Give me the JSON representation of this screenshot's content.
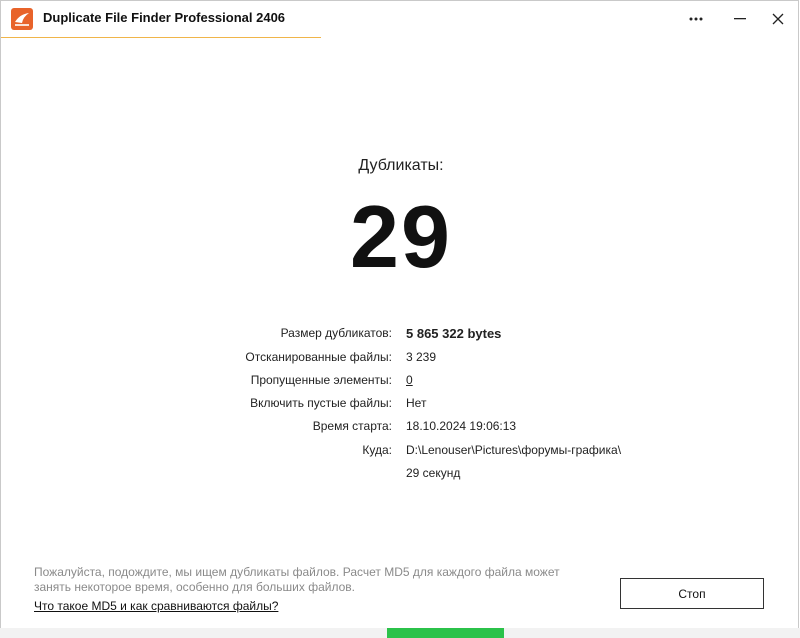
{
  "window": {
    "title": "Duplicate File Finder Professional 2406"
  },
  "duplicates": {
    "label": "Дубликаты:",
    "count": "29"
  },
  "info": [
    {
      "label": "Размер дубликатов:",
      "value": "5 865 322 bytes"
    },
    {
      "label": "Отсканированные файлы:",
      "value": "3 239"
    },
    {
      "label": "Пропущенные элементы:",
      "value": "0"
    },
    {
      "label": "Включить пустые файлы:",
      "value": "Нет"
    },
    {
      "label": "Время старта:",
      "value": "18.10.2024 19:06:13"
    },
    {
      "label": "Куда:",
      "value": "D:\\Lenouser\\Pictures\\форумы-графика\\"
    },
    {
      "label": "",
      "value": "29 секунд"
    }
  ],
  "footer": {
    "message": "Пожалуйста, подождите, мы ищем дубликаты файлов. Расчет MD5 для каждого файла может занять некоторое время, особенно для больших файлов.",
    "link": "Что такое MD5 и как сравниваются файлы?",
    "stop_label": "Стоп"
  },
  "progress": {
    "indeterminate": true
  },
  "colors": {
    "accent": "#f0b54a",
    "progress": "#2bc24a",
    "icon_bg": "#e8632a"
  },
  "icons": {
    "app": "app-logo-icon",
    "more": "more-dots-icon",
    "minimize": "minimize-icon",
    "close": "close-icon"
  }
}
